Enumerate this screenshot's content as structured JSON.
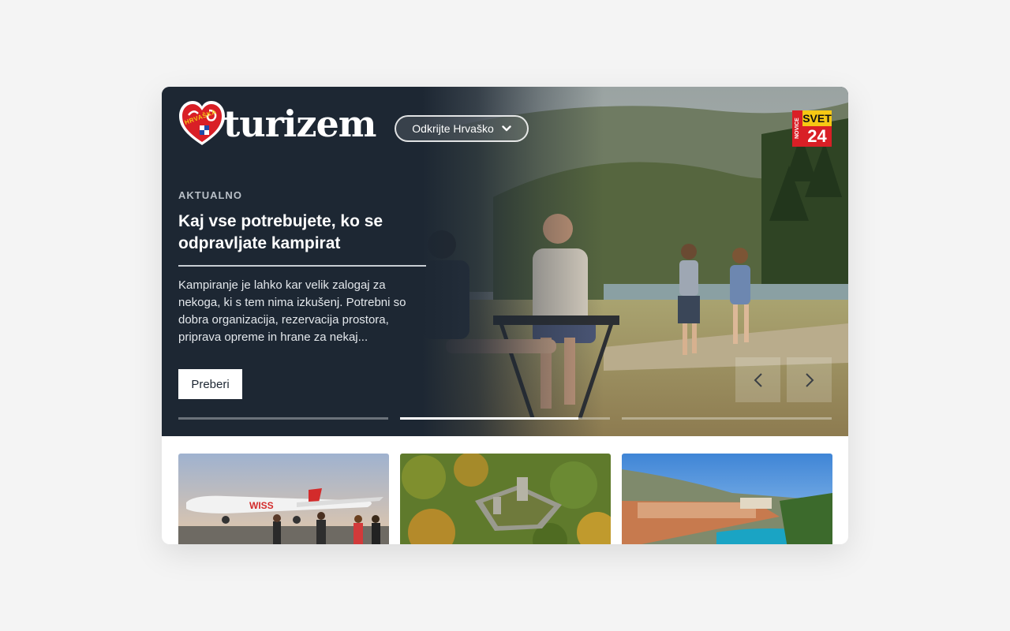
{
  "header": {
    "logo_text": "turizem",
    "logo_badge_text": "HRVAŠKA",
    "dropdown_label": "Odkrijte Hrvaško",
    "partner_logo": {
      "top": "NOVICE",
      "name": "SVET",
      "number": "24"
    }
  },
  "hero": {
    "kicker": "AKTUALNO",
    "headline": "Kaj vse potrebujete, ko se odpravljate kampirat",
    "excerpt": "Kampiranje je lahko kar velik zalogaj za nekoga, ki s tem nima izkušenj. Potrebni so dobra organizacija, rezervacija prostora, priprava opreme in hrane za nekaj...",
    "button_label": "Preberi",
    "slides_progress": [
      0,
      0.85,
      0
    ]
  },
  "cards": [
    {
      "image": "airplane-at-airport"
    },
    {
      "image": "castle-in-forest"
    },
    {
      "image": "dubrovnik-coast"
    }
  ],
  "colors": {
    "hero_bg": "#1d2733",
    "page_bg": "#f4f4f4",
    "logo_red": "#d91f26",
    "partner_yellow": "#f6c814"
  }
}
